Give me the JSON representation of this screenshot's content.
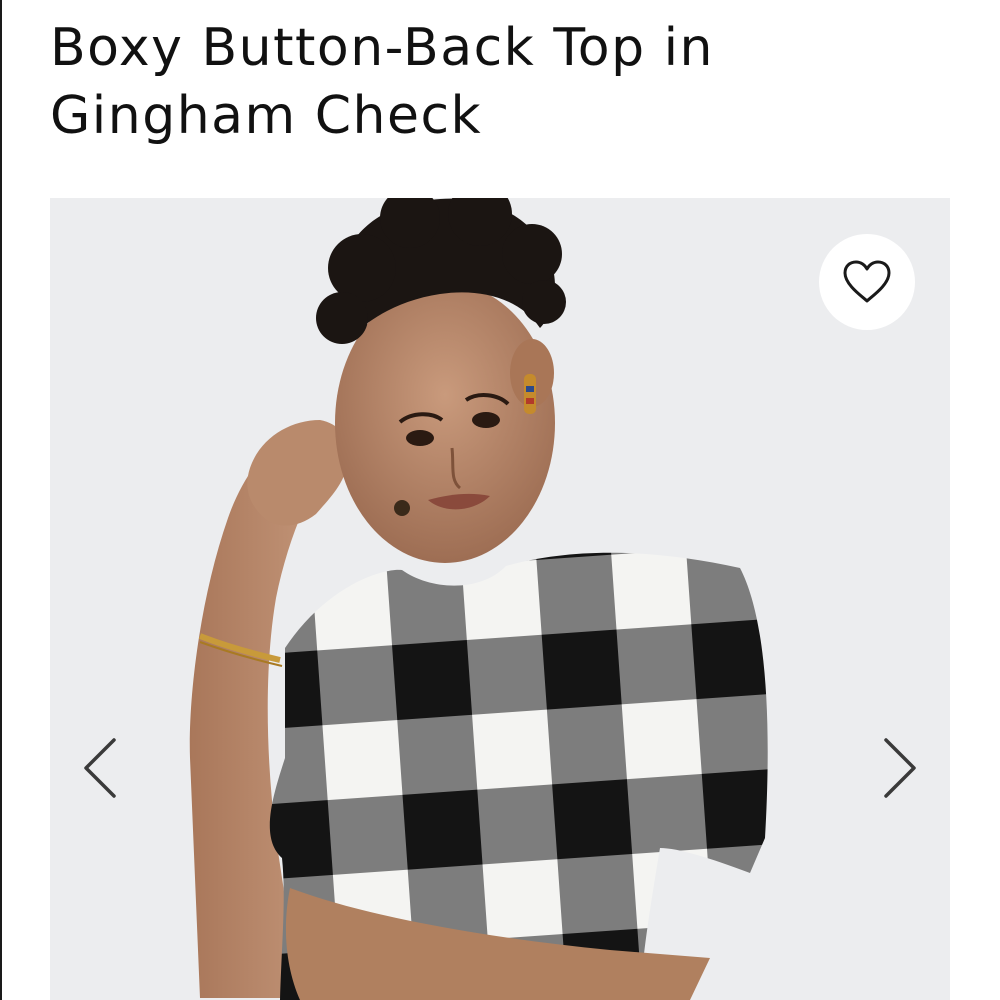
{
  "product": {
    "title": "Boxy Button-Back Top in Gingham Check"
  },
  "gallery": {
    "background_color": "#ecedef",
    "favorite_icon": "heart-outline-icon",
    "prev_icon": "chevron-left-icon",
    "next_icon": "chevron-right-icon"
  }
}
